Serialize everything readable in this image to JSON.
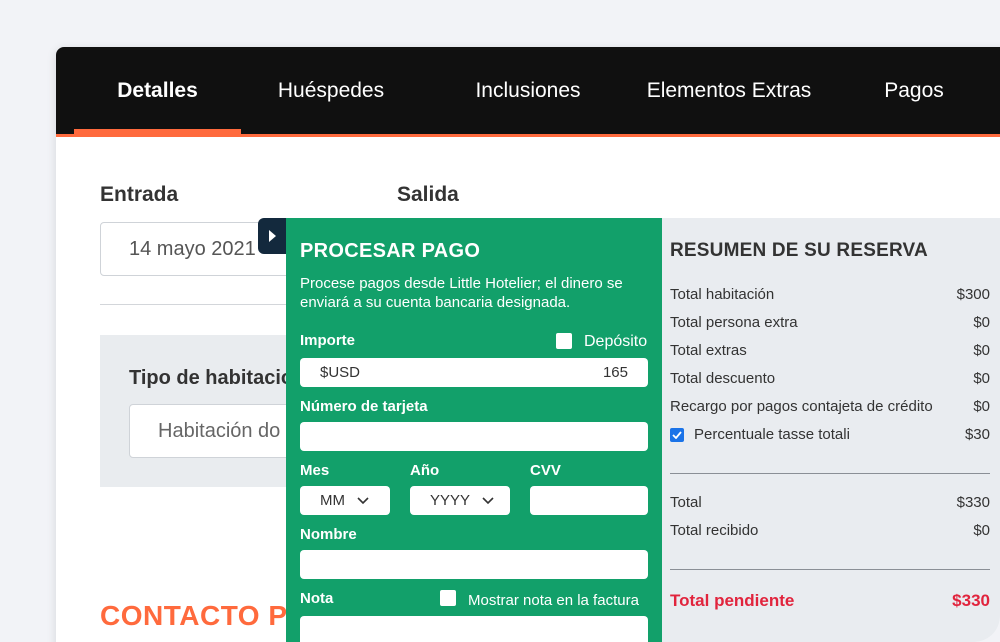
{
  "tabs": [
    {
      "label": "Detalles"
    },
    {
      "label": "Huéspedes"
    },
    {
      "label": "Inclusiones"
    },
    {
      "label": "Elementos Extras"
    },
    {
      "label": "Pagos"
    }
  ],
  "booking": {
    "checkin_label": "Entrada",
    "checkout_label": "Salida",
    "checkin_value": "14 mayo 2021",
    "room_type_label": "Tipo de habitacio",
    "room_type_value": "Habitación do",
    "contact_heading": "CONTACTO PI"
  },
  "payment": {
    "title": "PROCESAR PAGO",
    "description": "Procese pagos desde Little Hotelier; el dinero se enviará a su cuenta bancaria designada.",
    "amount_label": "Importe",
    "deposit_label": "Depósito",
    "currency": "$USD",
    "amount_value": "165",
    "card_label": "Número de tarjeta",
    "month_label": "Mes",
    "year_label": "Año",
    "cvv_label": "CVV",
    "month_placeholder": "MM",
    "year_placeholder": "YYYY",
    "name_label": "Nombre",
    "note_label": "Nota",
    "show_note_label": "Mostrar nota en la factura"
  },
  "summary": {
    "title": "RESUMEN DE SU RESERVA",
    "rows": [
      {
        "label": "Total habitación",
        "value": "$300"
      },
      {
        "label": "Total persona extra",
        "value": "$0"
      },
      {
        "label": "Total extras",
        "value": "$0"
      },
      {
        "label": "Total descuento",
        "value": "$0"
      },
      {
        "label": "Recargo por pagos contajeta de crédito",
        "value": "$0"
      },
      {
        "label": "Percentuale tasse totali",
        "value": "$30"
      }
    ],
    "total_label": "Total",
    "total_value": "$330",
    "received_label": "Total recibido",
    "received_value": "$0",
    "pending_label": "Total pendiente",
    "pending_value": "$330"
  },
  "colors": {
    "accent": "#ff6a3d",
    "payment_green": "#12a06a",
    "pending_red": "#e1243d"
  }
}
